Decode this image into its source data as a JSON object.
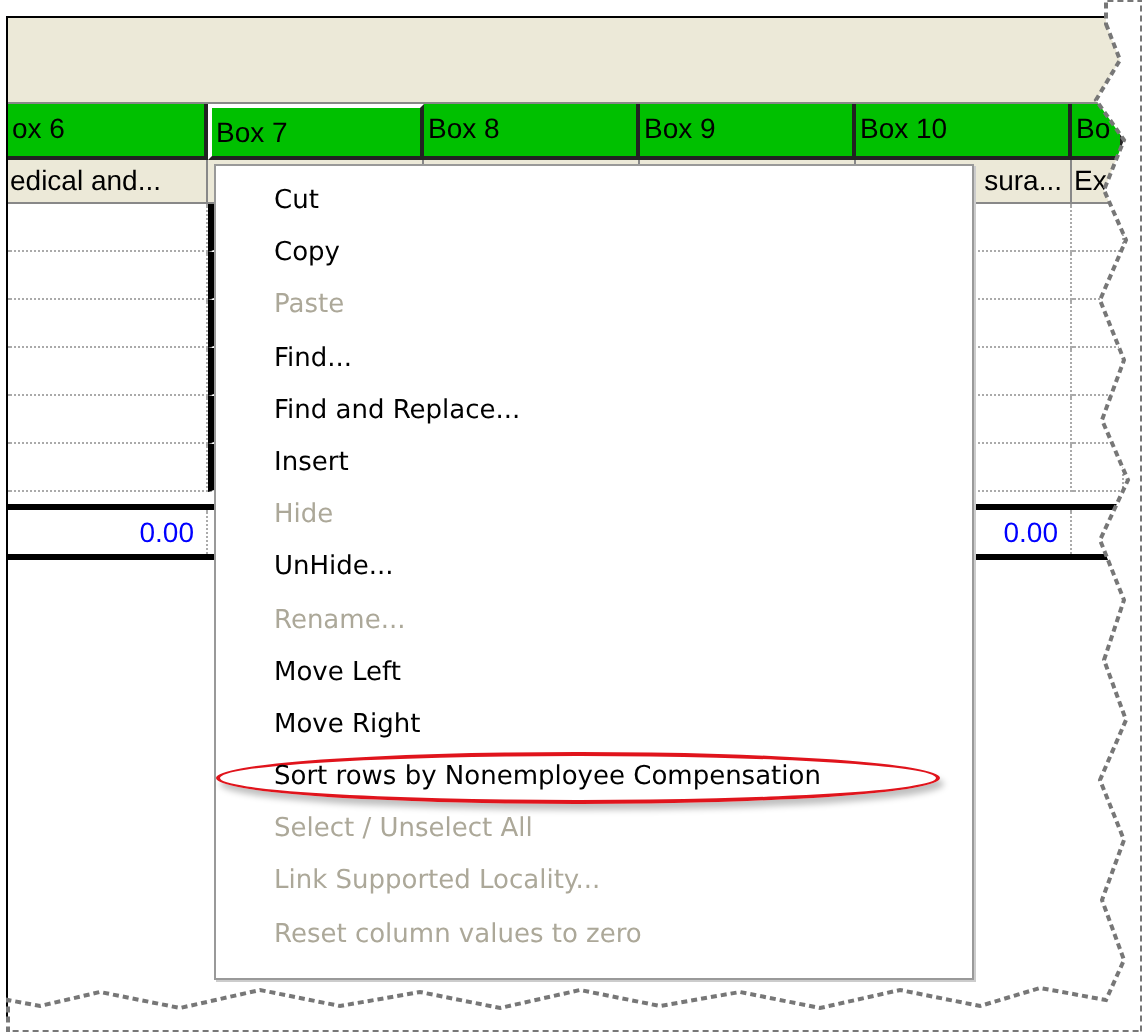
{
  "columns": [
    {
      "header": "ox 6",
      "subheader": "edical and...",
      "total": "0.00",
      "selected": false
    },
    {
      "header": "Box 7",
      "selected": true
    },
    {
      "header": "Box 8",
      "selected": false
    },
    {
      "header": "Box 9",
      "selected": false
    },
    {
      "header": "Box 10",
      "subheader": "sura...",
      "total": "0.00",
      "selected": false
    },
    {
      "header": "Bo",
      "subheader": "Ex",
      "selected": false
    }
  ],
  "context_menu": {
    "items": [
      {
        "label": "Cut",
        "disabled": false,
        "circled": false
      },
      {
        "label": "Copy",
        "disabled": false,
        "circled": false
      },
      {
        "label": "Paste",
        "disabled": true,
        "circled": false
      },
      {
        "label": "Find...",
        "disabled": false,
        "circled": false
      },
      {
        "label": "Find and Replace...",
        "disabled": false,
        "circled": false
      },
      {
        "label": "Insert",
        "disabled": false,
        "circled": false
      },
      {
        "label": "Hide",
        "disabled": true,
        "circled": false
      },
      {
        "label": "UnHide...",
        "disabled": false,
        "circled": false
      },
      {
        "label": "Rename...",
        "disabled": true,
        "circled": false
      },
      {
        "label": "Move Left",
        "disabled": false,
        "circled": false
      },
      {
        "label": "Move Right",
        "disabled": false,
        "circled": false
      },
      {
        "label": "Sort rows by Nonemployee Compensation",
        "disabled": false,
        "circled": true
      },
      {
        "label": "Select / Unselect All",
        "disabled": true,
        "circled": false
      },
      {
        "label": "Link Supported Locality...",
        "disabled": true,
        "circled": false
      },
      {
        "label": "Reset column values to zero",
        "disabled": true,
        "circled": false
      }
    ]
  }
}
